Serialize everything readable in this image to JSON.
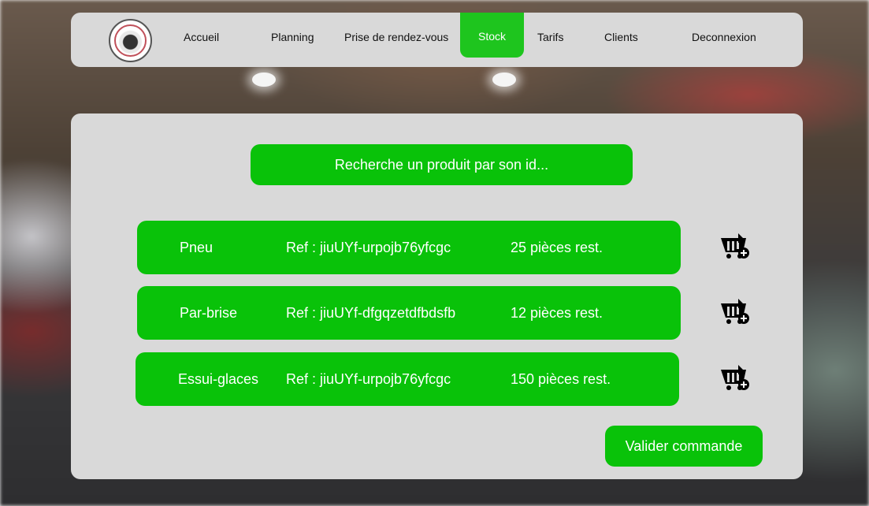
{
  "nav": {
    "items": [
      {
        "label": "Accueil"
      },
      {
        "label": "Planning"
      },
      {
        "label": "Prise de rendez-vous"
      },
      {
        "label": "Stock",
        "active": true
      },
      {
        "label": "Tarifs"
      },
      {
        "label": "Clients"
      },
      {
        "label": "Deconnexion"
      }
    ]
  },
  "search": {
    "placeholder": "Recherche un produit par son id..."
  },
  "products": [
    {
      "name": "Pneu",
      "ref": "Ref : jiuUYf-urpojb76yfcgc",
      "stock": "25 pièces rest."
    },
    {
      "name": "Par-brise",
      "ref": "Ref : jiuUYf-dfgqzetdfbdsfb",
      "stock": "12 pièces rest."
    },
    {
      "name": "Essui-glaces",
      "ref": "Ref : jiuUYf-urpojb76yfcgc",
      "stock": "150 pièces rest."
    }
  ],
  "actions": {
    "validate_label": "Valider commande"
  },
  "colors": {
    "accent": "#09c209",
    "panel": "#d9d9d9",
    "nav_active": "#1ec51e"
  },
  "icons": {
    "logo": "garage-logo",
    "row_action": "cart-add-icon"
  }
}
